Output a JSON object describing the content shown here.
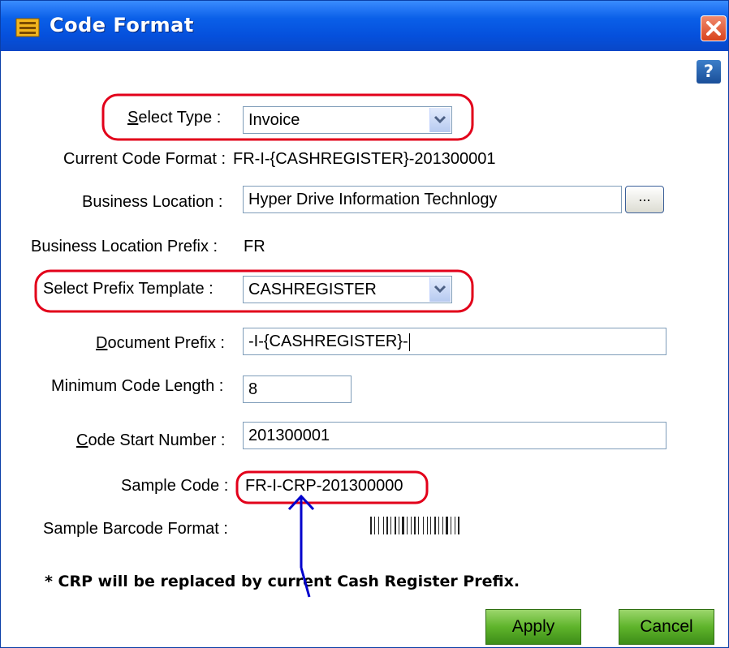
{
  "window": {
    "title": "Code Format",
    "icons": {
      "app": "shopping-cart-icon",
      "close": "close-icon",
      "help": "help-icon"
    },
    "colors": {
      "titlebar": "#0550dc",
      "annotation": "#e2001a",
      "arrow": "#0000cc",
      "button": "#5fb42b"
    }
  },
  "help": {
    "label": "?"
  },
  "form": {
    "select_type": {
      "label_key": "S",
      "label_rest": "elect Type :",
      "value": "Invoice"
    },
    "current_code_format": {
      "label": "Current Code Format :",
      "value": "FR-I-{CASHREGISTER}-201300001"
    },
    "business_location": {
      "label": "Business Location :",
      "value": "Hyper Drive Information Technlogy",
      "browse_label": "..."
    },
    "business_location_prefix": {
      "label": "Business Location Prefix :",
      "value": "FR"
    },
    "prefix_template": {
      "label": "Select Prefix Template :",
      "value": "CASHREGISTER"
    },
    "document_prefix": {
      "label_key": "D",
      "label_rest": "ocument Prefix :",
      "value": "-I-{CASHREGISTER}-"
    },
    "min_code_length": {
      "label": "Minimum Code Length :",
      "value": "8"
    },
    "code_start_number": {
      "label_key": "C",
      "label_rest": "ode Start Number :",
      "value": "201300001"
    },
    "sample_code": {
      "label": "Sample Code :",
      "value": "FR-I-CRP-201300000"
    },
    "sample_barcode": {
      "label": "Sample Barcode Format :"
    }
  },
  "footnote": "* CRP will be replaced by current Cash Register Prefix.",
  "buttons": {
    "apply": "Apply",
    "cancel": "Cancel"
  }
}
